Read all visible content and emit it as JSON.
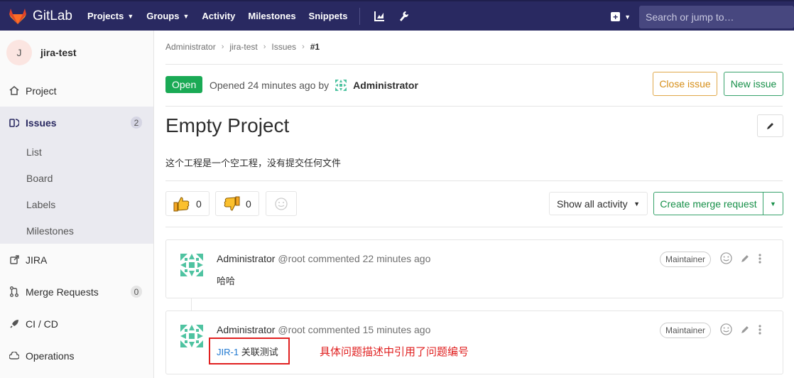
{
  "topbar": {
    "brand": "GitLab",
    "nav": [
      {
        "label": "Projects",
        "dropdown": true
      },
      {
        "label": "Groups",
        "dropdown": true
      },
      {
        "label": "Activity",
        "dropdown": false
      },
      {
        "label": "Milestones",
        "dropdown": false
      },
      {
        "label": "Snippets",
        "dropdown": false
      }
    ],
    "search_placeholder": "Search or jump to…"
  },
  "sidebar": {
    "project_initial": "J",
    "project_name": "jira-test",
    "items": [
      {
        "label": "Project",
        "icon": "home-icon"
      },
      {
        "label": "Issues",
        "icon": "issues-icon",
        "count": "2",
        "active": true
      },
      {
        "label": "JIRA",
        "icon": "external-link-icon"
      },
      {
        "label": "Merge Requests",
        "icon": "merge-request-icon",
        "count": "0"
      },
      {
        "label": "CI / CD",
        "icon": "rocket-icon"
      },
      {
        "label": "Operations",
        "icon": "cloud-gear-icon"
      }
    ],
    "issues_subitems": [
      "List",
      "Board",
      "Labels",
      "Milestones"
    ]
  },
  "breadcrumb": [
    "Administrator",
    "jira-test",
    "Issues",
    "#1"
  ],
  "issue": {
    "status": "Open",
    "opened_text": "Opened 24 minutes ago by",
    "author": "Administrator",
    "close_label": "Close issue",
    "new_label": "New issue",
    "title": "Empty Project",
    "description": "这个工程是一个空工程，没有提交任何文件",
    "thumbs_up": "0",
    "thumbs_down": "0",
    "activity_filter": "Show all activity",
    "create_mr_label": "Create merge request"
  },
  "notes": [
    {
      "author": "Administrator",
      "handle": "@root",
      "time": "commented 22 minutes ago",
      "role": "Maintainer",
      "body": "哈哈"
    },
    {
      "author": "Administrator",
      "handle": "@root",
      "time": "commented 15 minutes ago",
      "role": "Maintainer",
      "ref": "JIR-1",
      "body": "关联测试"
    }
  ],
  "annotation": "具体问题描述中引用了问题编号",
  "colors": {
    "nav_bg": "#292961",
    "open_green": "#1aaa55",
    "close_orange": "#e0a84a",
    "annotation_red": "#e02020",
    "link_blue": "#1f78d1"
  }
}
